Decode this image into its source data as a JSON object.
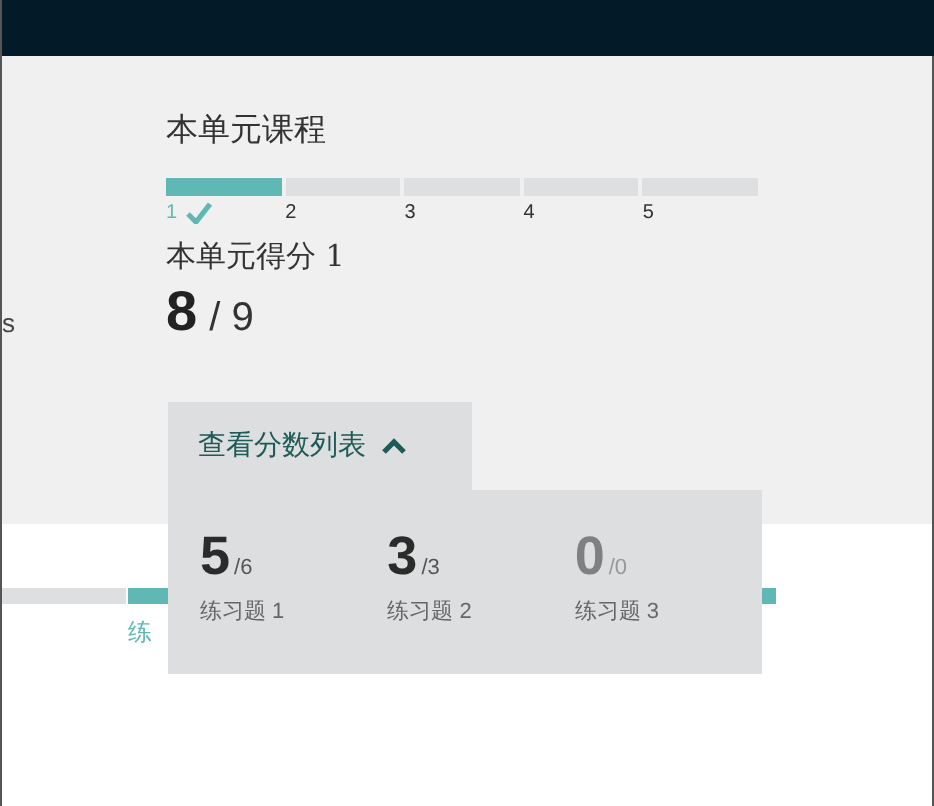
{
  "left_fragments": [
    "s"
  ],
  "course": {
    "title": "本单元课程",
    "segments": [
      {
        "label": "1",
        "completed": true
      },
      {
        "label": "2",
        "completed": false
      },
      {
        "label": "3",
        "completed": false
      },
      {
        "label": "4",
        "completed": false
      },
      {
        "label": "5",
        "completed": false
      }
    ]
  },
  "score": {
    "title": "本单元得分 1",
    "value": "8",
    "total": "/ 9"
  },
  "behind": {
    "link": "练"
  },
  "score_list": {
    "toggle": "查看分数列表",
    "expanded": true,
    "items": [
      {
        "score": "5",
        "total": "/6",
        "label": "练习题 1",
        "disabled": false
      },
      {
        "score": "3",
        "total": "/3",
        "label": "练习题 2",
        "disabled": false
      },
      {
        "score": "0",
        "total": "/0",
        "label": "练习题 3",
        "disabled": true
      }
    ]
  }
}
